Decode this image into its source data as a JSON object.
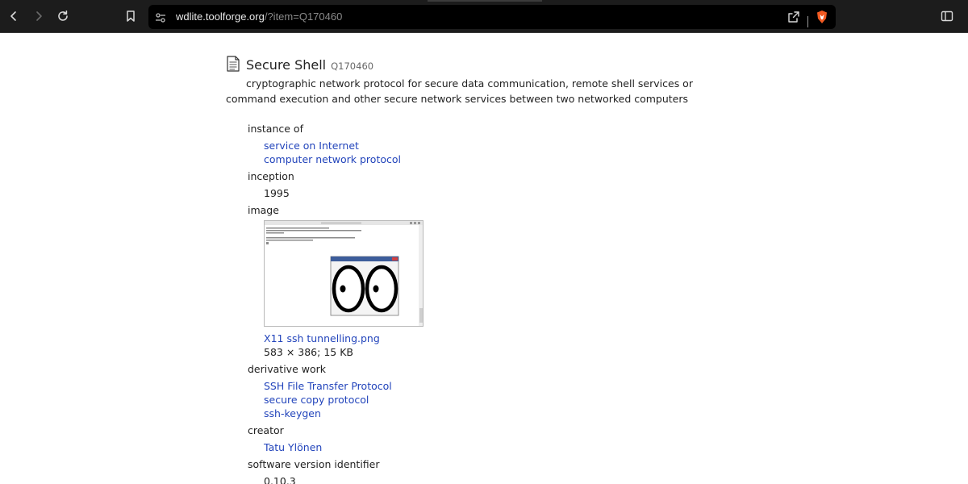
{
  "browser": {
    "url_host": "wdlite.toolforge.org",
    "url_path": "/?item=Q170460"
  },
  "page": {
    "title": "Secure Shell",
    "qid": "Q170460",
    "description": "cryptographic network protocol for secure data communication, remote shell services or command execution and other secure network services between two networked computers"
  },
  "properties": {
    "instance_of": {
      "label": "instance of",
      "values": [
        "service on Internet",
        "computer network protocol"
      ]
    },
    "inception": {
      "label": "inception",
      "value": "1995"
    },
    "image": {
      "label": "image",
      "filename": "X11 ssh tunnelling.png",
      "meta": "583 × 386; 15 KB"
    },
    "derivative_work": {
      "label": "derivative work",
      "values": [
        "SSH File Transfer Protocol",
        "secure copy protocol",
        "ssh-keygen"
      ]
    },
    "creator": {
      "label": "creator",
      "value": "Tatu Ylönen"
    },
    "software_version": {
      "label": "software version identifier",
      "value": "0.10.3"
    }
  },
  "colors": {
    "link": "#2244bb",
    "toolbar_bg": "#1c1c1c",
    "brave_orange": "#f15a22"
  },
  "icons": [
    "back-icon",
    "forward-icon",
    "reload-icon",
    "bookmark-icon",
    "site-info-icon",
    "share-icon",
    "brave-shield-icon",
    "sidebar-toggle-icon",
    "document-icon"
  ]
}
